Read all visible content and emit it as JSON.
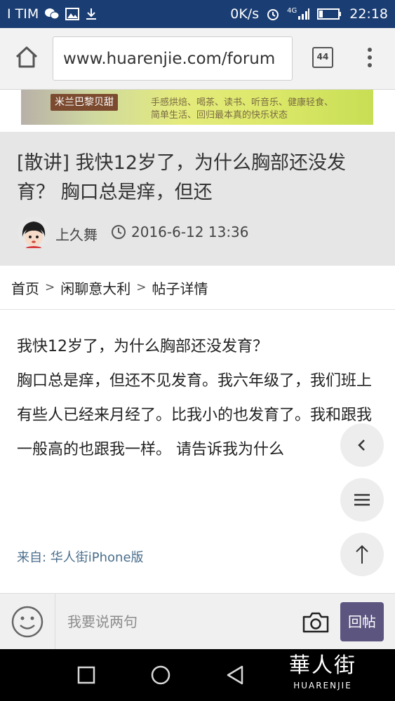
{
  "status_bar": {
    "carrier": "I TIM",
    "net_speed": "0K/s",
    "network": "4G",
    "time": "22:18"
  },
  "browser": {
    "url": "www.huarenjie.com/forum",
    "tab_count": "44"
  },
  "banner": {
    "logo_text": "米兰巴黎贝甜",
    "tagline_line1": "手感烘焙、喝茶、读书、听音乐、健康轻食、",
    "tagline_line2": "简单生活、回归最本真的快乐状态"
  },
  "post": {
    "title": "[散讲] 我快12岁了，为什么胸部还没发育？ 胸口总是痒，但还",
    "author": "上久舞",
    "date": "2016-6-12 13:36",
    "body_line1": "我快12岁了，为什么胸部还没发育？",
    "body_line2": "胸口总是痒，但还不见发育。我六年级了，我们班上有些人已经来月经了。比我小的也发育了。我和跟我一般高的也跟我一样。 请告诉我为什么",
    "source": "来自: 华人街iPhone版"
  },
  "breadcrumb": {
    "home": "首页",
    "forum": "闲聊意大利",
    "current": "帖子详情",
    "sep": ">"
  },
  "reply_bar": {
    "placeholder": "我要说两句",
    "reply_button": "回帖"
  },
  "watermark": {
    "cn": "華人街",
    "en": "HUARENJIE"
  }
}
